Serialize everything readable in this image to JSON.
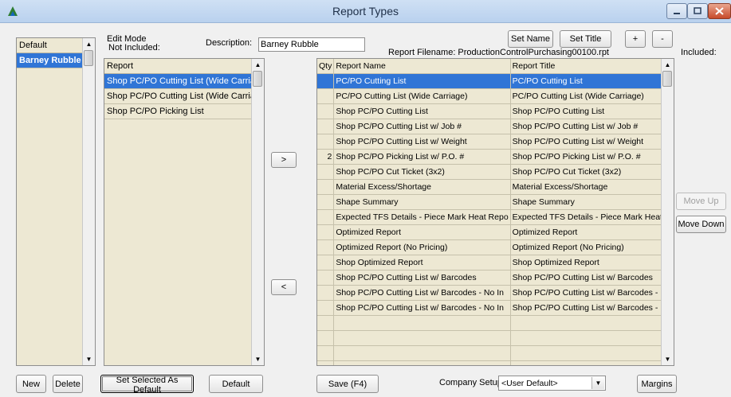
{
  "window": {
    "title": "Report Types"
  },
  "left_list": {
    "header": "Default",
    "items": [
      {
        "label": "Barney Rubble",
        "selected": true
      }
    ]
  },
  "labels": {
    "edit_mode": "Edit Mode",
    "not_included": "Not Included:",
    "description": "Description:",
    "report_filename": "Report Filename: ProductionControlPurchasing00100.rpt",
    "included": "Included:",
    "company_setup": "Company Setup:"
  },
  "description_value": "Barney Rubble",
  "buttons": {
    "set_name": "Set Name",
    "set_title": "Set Title",
    "plus": "+",
    "minus": "-",
    "move_right": ">",
    "move_left": "<",
    "move_up": "Move Up",
    "move_down": "Move Down",
    "new": "New",
    "delete": "Delete",
    "set_selected_default": "Set Selected As Default",
    "default": "Default",
    "save": "Save (F4)",
    "margins": "Margins"
  },
  "not_included_list": {
    "header": "Report",
    "items": [
      {
        "label": "Shop PC/PO Cutting List (Wide Carriage)",
        "selected": true
      },
      {
        "label": "Shop PC/PO Cutting List (Wide Carriage)",
        "selected": false
      },
      {
        "label": "Shop PC/PO Picking List",
        "selected": false
      }
    ]
  },
  "included_grid": {
    "columns": [
      "Qty",
      "Report Name",
      "Report Title"
    ],
    "rows": [
      {
        "qty": "",
        "name": "PC/PO Cutting List",
        "title": "PC/PO Cutting List",
        "selected": true
      },
      {
        "qty": "",
        "name": "PC/PO Cutting List (Wide Carriage)",
        "title": "PC/PO Cutting List (Wide Carriage)",
        "selected": false
      },
      {
        "qty": "",
        "name": "Shop PC/PO Cutting List",
        "title": "Shop PC/PO Cutting List",
        "selected": false
      },
      {
        "qty": "",
        "name": "Shop PC/PO Cutting List w/ Job #",
        "title": "Shop PC/PO Cutting List w/ Job #",
        "selected": false
      },
      {
        "qty": "",
        "name": "Shop PC/PO Cutting List w/ Weight",
        "title": "Shop PC/PO Cutting List w/ Weight",
        "selected": false
      },
      {
        "qty": "2",
        "name": "Shop PC/PO Picking List w/ P.O. #",
        "title": "Shop PC/PO Picking List w/ P.O. #",
        "selected": false
      },
      {
        "qty": "",
        "name": "Shop PC/PO Cut Ticket (3x2)",
        "title": "Shop PC/PO Cut Ticket (3x2)",
        "selected": false
      },
      {
        "qty": "",
        "name": "Material Excess/Shortage",
        "title": "Material Excess/Shortage",
        "selected": false
      },
      {
        "qty": "",
        "name": "Shape Summary",
        "title": "Shape Summary",
        "selected": false
      },
      {
        "qty": "",
        "name": "Expected TFS Details - Piece Mark Heat Repo",
        "title": "Expected TFS Details - Piece Mark Heat Repo",
        "selected": false
      },
      {
        "qty": "",
        "name": "Optimized Report",
        "title": "Optimized Report",
        "selected": false
      },
      {
        "qty": "",
        "name": "Optimized Report (No Pricing)",
        "title": "Optimized Report (No Pricing)",
        "selected": false
      },
      {
        "qty": "",
        "name": "Shop Optimized Report",
        "title": "Shop Optimized Report",
        "selected": false
      },
      {
        "qty": "",
        "name": "Shop PC/PO Cutting List w/ Barcodes",
        "title": "Shop PC/PO Cutting List w/ Barcodes",
        "selected": false
      },
      {
        "qty": "",
        "name": "Shop PC/PO Cutting List w/ Barcodes - No In",
        "title": "Shop PC/PO Cutting List w/ Barcodes - No In",
        "selected": false
      },
      {
        "qty": "",
        "name": "Shop PC/PO Cutting List w/ Barcodes - No In",
        "title": "Shop PC/PO Cutting List w/ Barcodes - No In",
        "selected": false
      }
    ]
  },
  "company_setup_value": "<User Default>",
  "colors": {
    "selection": "#3075d6",
    "list_bg": "#ede8d3",
    "client_bg": "#f0f0f0"
  }
}
